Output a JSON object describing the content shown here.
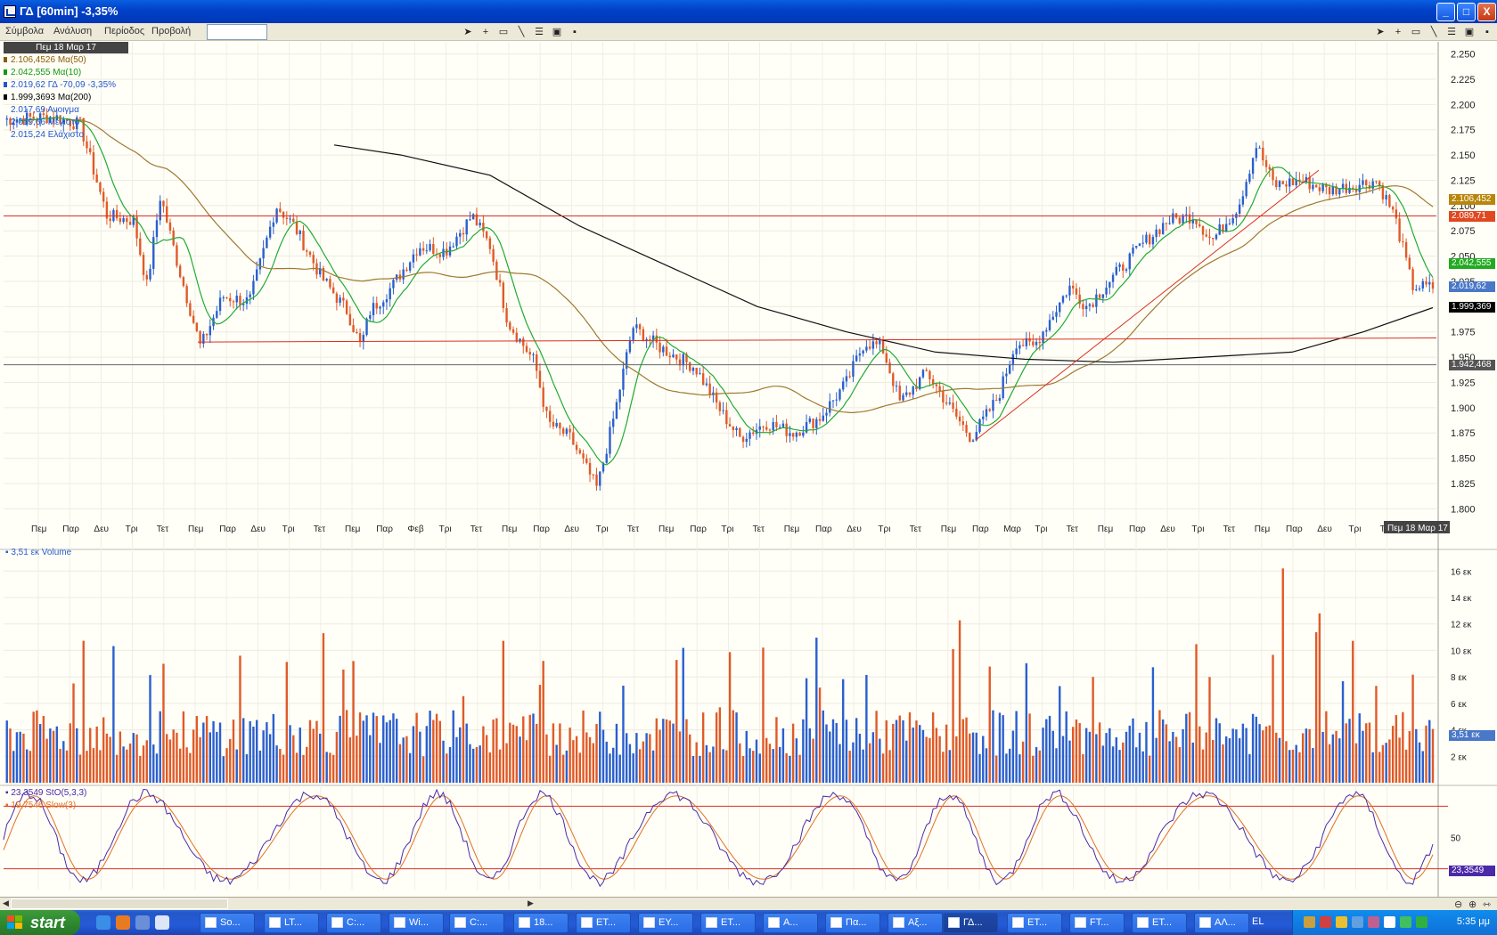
{
  "window": {
    "title": "ΓΔ [60min] -3,35%",
    "buttons": {
      "minimize": "_",
      "maximize": "□",
      "close": "X"
    }
  },
  "menu": {
    "items": [
      "Σύμβολα",
      "Ανάλυση",
      "Περίοδος",
      "Προβολή"
    ],
    "symbol_input_value": ""
  },
  "legend": {
    "date": "Πεμ 18 Μαρ 17",
    "rows": [
      {
        "text": "2.106,4526 Mα(50)",
        "color": "#8b5a00"
      },
      {
        "text": "2.042,555 Mα(10)",
        "color": "#119911"
      },
      {
        "text": "2.019,62 ΓΔ -70,09 -3,35%",
        "color": "#2255cc"
      },
      {
        "text": "1.999,3693 Mα(200)",
        "color": "#000000"
      },
      {
        "text": "2.017,69 Ανοιγμα",
        "color": "#2255cc"
      },
      {
        "text": "2.019,66 Μέγιστο",
        "color": "#2255cc"
      },
      {
        "text": "2.015,24 Ελάχιστο",
        "color": "#2255cc"
      }
    ]
  },
  "price_axis": {
    "ticks": [
      "2.250",
      "2.225",
      "2.200",
      "2.175",
      "2.150",
      "2.125",
      "2.100",
      "2.075",
      "2.050",
      "2.025",
      "2.000",
      "1.975",
      "1.950",
      "1.925",
      "1.900",
      "1.875",
      "1.850",
      "1.825",
      "1.800"
    ],
    "range": [
      1795,
      2262
    ]
  },
  "price_tags": [
    {
      "label": "2.106,452",
      "value": 2106.452,
      "color": "#b8860b"
    },
    {
      "label": "2.089,71",
      "value": 2089.71,
      "color": "#e04820"
    },
    {
      "label": "2.042,555",
      "value": 2042.555,
      "color": "#22aa22"
    },
    {
      "label": "2.019,62",
      "value": 2019.62,
      "color": "#4a78c8"
    },
    {
      "label": "1.999,369",
      "value": 1999.369,
      "color": "#000000"
    },
    {
      "label": "1.942,468",
      "value": 1942.468,
      "color": "#555555"
    }
  ],
  "time_axis": {
    "labels": [
      "Πεμ",
      "Παρ",
      "Δευ",
      "Τρι",
      "Τετ",
      "Πεμ",
      "Παρ",
      "Δευ",
      "Τρι",
      "Τετ",
      "Πεμ",
      "Παρ",
      "Φεβ",
      "Τρι",
      "Τετ",
      "Πεμ",
      "Παρ",
      "Δευ",
      "Τρι",
      "Τετ",
      "Πεμ",
      "Παρ",
      "Τρι",
      "Τετ",
      "Πεμ",
      "Παρ",
      "Δευ",
      "Τρι",
      "Τετ",
      "Πεμ",
      "Παρ",
      "Μαρ",
      "Τρι",
      "Τετ",
      "Πεμ",
      "Παρ",
      "Δευ",
      "Τρι",
      "Τετ",
      "Πεμ",
      "Παρ",
      "Δευ",
      "Τρι",
      "Τε"
    ],
    "current": "Πεμ 18 Μαρ 17"
  },
  "volume": {
    "legend": "3,51 εκ Volume",
    "ticks": [
      "16 εκ",
      "14 εκ",
      "12 εκ",
      "10 εκ",
      "8 εκ",
      "6 εκ",
      "4 εκ",
      "2 εκ"
    ],
    "current_tag": "3,51 εκ"
  },
  "stochastic": {
    "legend_fast": "23,3549 StO(5,3,3)",
    "legend_slow": "19,7546 Slow(3)",
    "tick": "50",
    "current_tag": "23,3549"
  },
  "colors": {
    "up": "#2a5fcf",
    "down": "#e05a28",
    "ma10": "#22aa33",
    "ma50": "#a07830",
    "ma200": "#111111",
    "hline": "#d83020",
    "stoch_fast": "#4b2aa8",
    "stoch_slow": "#e07020"
  },
  "taskbar": {
    "start": "start",
    "tasks": [
      "So...",
      "LT...",
      "C:...",
      "Wi...",
      "C:...",
      "18...",
      "ET...",
      "EY...",
      "ET...",
      "A...",
      "Πα...",
      "Αξ...",
      "ΓΔ...",
      "ET...",
      "FT...",
      "ET...",
      "AΛ..."
    ],
    "active_index": 12,
    "language": "EL",
    "clock": "5:35 μμ"
  }
}
